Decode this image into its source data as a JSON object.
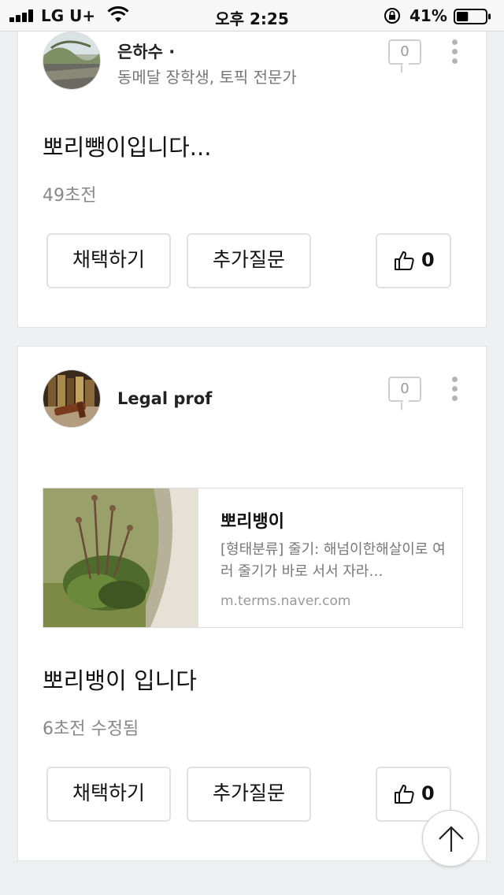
{
  "status_bar": {
    "carrier": "LG U+",
    "time": "오후 2:25",
    "battery_percent": "41%",
    "battery_level": 0.41
  },
  "answers": [
    {
      "author_name": "은하수 ·",
      "author_sub": "동메달 장학생, 토픽 전문가",
      "comment_count": "0",
      "text": "뽀리뺑이입니다...",
      "time": "49초전",
      "adopt_label": "채택하기",
      "followup_label": "추가질문",
      "like_count": "0"
    },
    {
      "author_name": "Legal prof",
      "comment_count": "0",
      "link": {
        "title": "뽀리뱅이",
        "description": "[형태분류] 줄기: 해넘이한해살이로 여러 줄기가 바로 서서 자라…",
        "domain": "m.terms.naver.com"
      },
      "text": "뽀리뱅이 입니다",
      "time": "6초전  수정됨",
      "adopt_label": "채택하기",
      "followup_label": "추가질문",
      "like_count": "0"
    }
  ],
  "icons": {
    "signal": "cellular-signal-icon",
    "wifi": "wifi-icon",
    "lock": "rotation-lock-icon",
    "battery": "battery-icon",
    "comment": "comment-bubble-icon",
    "more": "more-vertical-icon",
    "like": "thumbs-up-icon",
    "scroll_top": "arrow-up-icon"
  }
}
